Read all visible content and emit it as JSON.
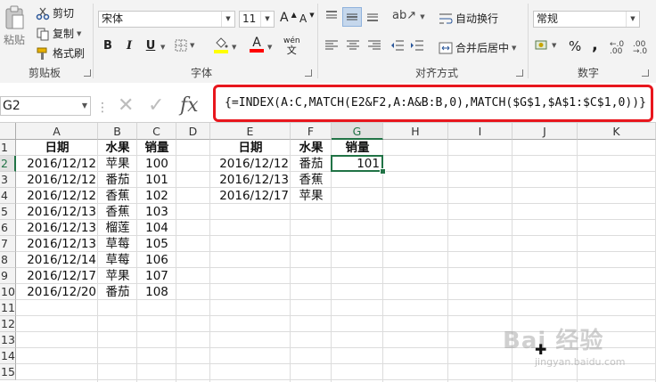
{
  "ribbon": {
    "clipboard": {
      "paste_label": "粘贴",
      "cut_label": "剪切",
      "copy_label": "复制",
      "format_painter_label": "格式刷",
      "group_label": "剪贴板"
    },
    "font": {
      "font_name": "宋体",
      "font_size": "11",
      "grow_label": "A",
      "shrink_label": "A",
      "bold": "B",
      "italic": "I",
      "underline": "U",
      "font_color_label": "A",
      "phonetic_label": "wén",
      "group_label": "字体"
    },
    "alignment": {
      "wrap_text_label": "自动换行",
      "merge_center_label": "合并后居中",
      "group_label": "对齐方式"
    },
    "number": {
      "format_value": "常规",
      "percent_label": "%",
      "comma_label": ",",
      "group_label": "数字"
    }
  },
  "formula_bar": {
    "name_box": "G2",
    "fx_label": "fx",
    "formula": "{=INDEX(A:C,MATCH(E2&F2,A:A&B:B,0),MATCH($G$1,$A$1:$C$1,0))}"
  },
  "sheet": {
    "columns": [
      "A",
      "B",
      "C",
      "D",
      "E",
      "F",
      "G",
      "H",
      "I",
      "J",
      "K"
    ],
    "rows": [
      "1",
      "2",
      "3",
      "4",
      "5",
      "6",
      "7",
      "8",
      "9",
      "10",
      "11",
      "12",
      "13",
      "14",
      "15"
    ],
    "cells": {
      "A1": "日期",
      "B1": "水果",
      "C1": "销量",
      "A2": "2016/12/12",
      "B2": "苹果",
      "C2": "100",
      "A3": "2016/12/12",
      "B3": "番茄",
      "C3": "101",
      "A4": "2016/12/12",
      "B4": "香蕉",
      "C4": "102",
      "A5": "2016/12/13",
      "B5": "香蕉",
      "C5": "103",
      "A6": "2016/12/13",
      "B6": "榴莲",
      "C6": "104",
      "A7": "2016/12/13",
      "B7": "草莓",
      "C7": "105",
      "A8": "2016/12/14",
      "B8": "草莓",
      "C8": "106",
      "A9": "2016/12/17",
      "B9": "苹果",
      "C9": "107",
      "A10": "2016/12/20",
      "B10": "番茄",
      "C10": "108",
      "E1": "日期",
      "F1": "水果",
      "G1": "销量",
      "E2": "2016/12/12",
      "F2": "番茄",
      "G2": "101",
      "E3": "2016/12/13",
      "F3": "香蕉",
      "E4": "2016/12/17",
      "F4": "苹果"
    },
    "selected_column": "G",
    "selected_row": "2",
    "selection_color": "#217346"
  },
  "watermark": {
    "text": "Bai  经验",
    "url": "jingyan.baidu.com"
  },
  "colors": {
    "highlight_border": "#e8161d",
    "ribbon_bg": "#f3f3f3",
    "fill_color_swatch": "#ffff00",
    "font_color_swatch": "#ff0000"
  }
}
